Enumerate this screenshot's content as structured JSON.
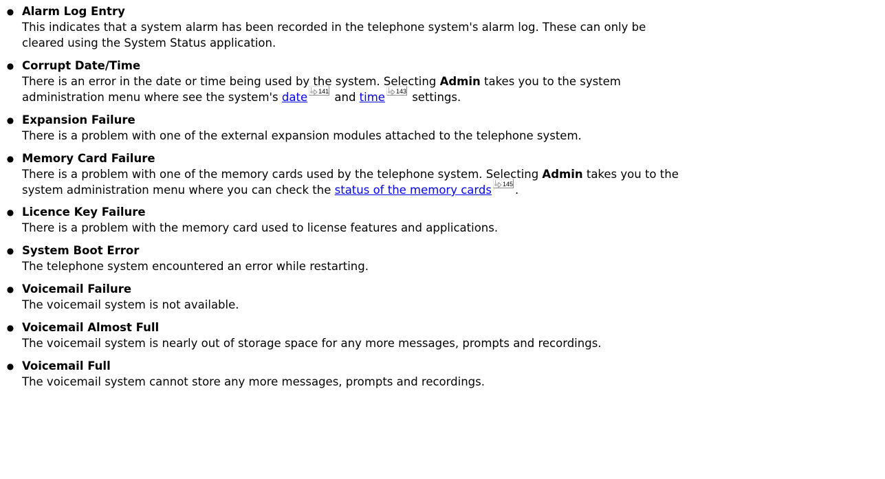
{
  "items": [
    {
      "title": "Alarm Log Entry",
      "desc": [
        "This indicates that a system alarm has been recorded in the telephone system's alarm log. These can only be",
        "cleared using the System Status application."
      ]
    },
    {
      "title": "Corrupt Date/Time",
      "desc_l1": {
        "a": "There is an error in the date or time being used by the system. Selecting ",
        "bold": "Admin",
        "b": " takes you to the system"
      },
      "desc_l2": {
        "a": "administration menu where see the system's ",
        "link1": "date",
        "ref1": "141",
        "b": " and ",
        "link2": "time",
        "ref2": "143",
        "c": " settings."
      }
    },
    {
      "title": "Expansion Failure",
      "desc": [
        "There is a problem with one of the external expansion modules attached to the telephone system."
      ]
    },
    {
      "title": "Memory Card Failure",
      "desc_l1": {
        "a": "There is a problem with one of the memory cards used by the telephone system. Selecting ",
        "bold": "Admin",
        "b": " takes you to the"
      },
      "desc_l2": {
        "a": "system administration menu where you can check the ",
        "link1": "status of the memory cards",
        "ref1": "145",
        "b": "."
      }
    },
    {
      "title": "Licence Key Failure",
      "desc": [
        "There is a problem with the memory card used to license features and applications."
      ]
    },
    {
      "title": "System Boot Error",
      "desc": [
        "The telephone system encountered an error while restarting."
      ]
    },
    {
      "title": "Voicemail Failure",
      "desc": [
        "The voicemail system is not available."
      ]
    },
    {
      "title": "Voicemail Almost Full",
      "desc": [
        "The voicemail system is nearly out of storage space for any more messages, prompts and recordings."
      ]
    },
    {
      "title": "Voicemail Full",
      "desc": [
        "The voicemail system cannot store any more messages, prompts and recordings."
      ]
    }
  ],
  "colors": {
    "text": "#000000",
    "link": "#0000ee",
    "background": "#ffffff"
  },
  "icons": {
    "bullet": "bullet-dot",
    "pageref": "page-reference-arrow-icon"
  }
}
